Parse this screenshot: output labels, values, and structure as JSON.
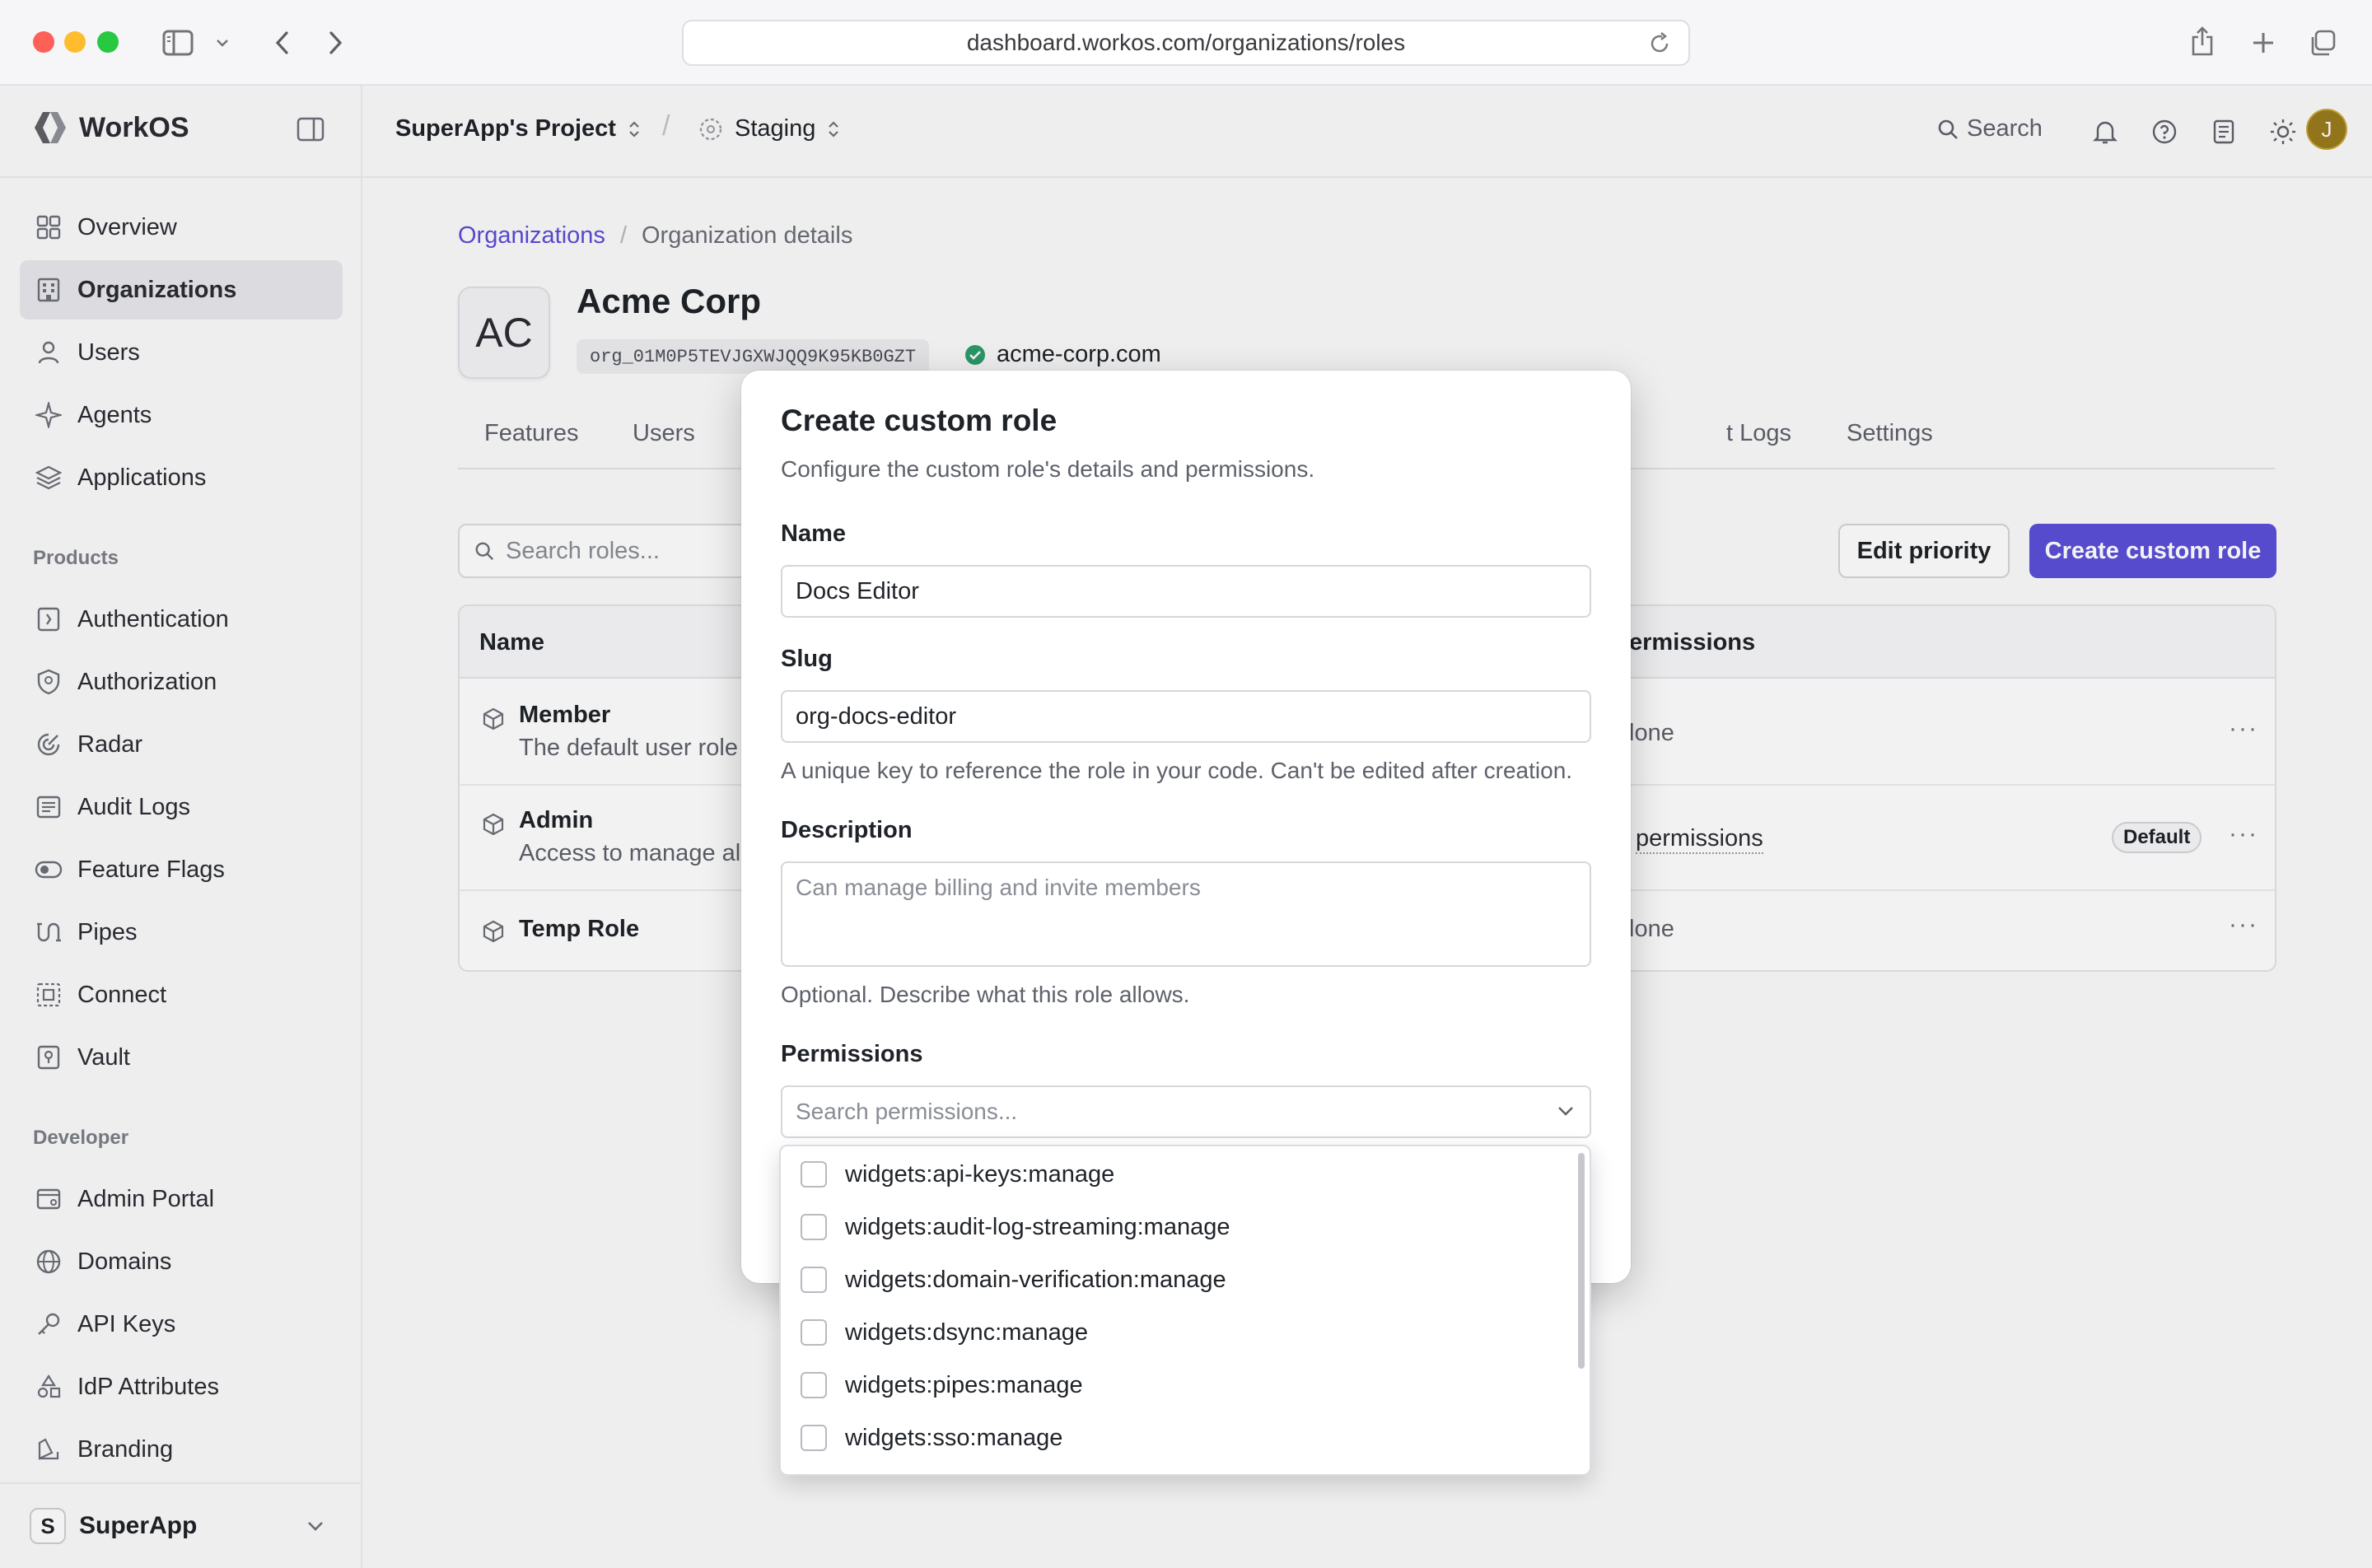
{
  "browser": {
    "url": "dashboard.workos.com/organizations/roles"
  },
  "sidebar": {
    "brand": "WorkOS",
    "items": [
      {
        "label": "Overview",
        "icon": "grid-icon"
      },
      {
        "label": "Organizations",
        "icon": "building-icon",
        "active": true
      },
      {
        "label": "Users",
        "icon": "user-icon"
      },
      {
        "label": "Agents",
        "icon": "sparkle-icon"
      },
      {
        "label": "Applications",
        "icon": "layers-icon"
      }
    ],
    "products_label": "Products",
    "products": [
      {
        "label": "Authentication",
        "icon": "key-card-icon"
      },
      {
        "label": "Authorization",
        "icon": "shield-icon"
      },
      {
        "label": "Radar",
        "icon": "radar-icon"
      },
      {
        "label": "Audit Logs",
        "icon": "list-icon"
      },
      {
        "label": "Feature Flags",
        "icon": "toggle-icon"
      },
      {
        "label": "Pipes",
        "icon": "pipes-icon"
      },
      {
        "label": "Connect",
        "icon": "connect-icon"
      },
      {
        "label": "Vault",
        "icon": "vault-icon"
      }
    ],
    "developer_label": "Developer",
    "developer": [
      {
        "label": "Admin Portal",
        "icon": "portal-icon"
      },
      {
        "label": "Domains",
        "icon": "globe-icon"
      },
      {
        "label": "API Keys",
        "icon": "key-icon"
      },
      {
        "label": "IdP Attributes",
        "icon": "shapes-icon"
      },
      {
        "label": "Branding",
        "icon": "brush-icon"
      }
    ],
    "workspace": {
      "initial": "S",
      "name": "SuperApp"
    }
  },
  "topbar": {
    "project": "SuperApp's Project",
    "environment": "Staging",
    "search_label": "Search",
    "user_initial": "J"
  },
  "page": {
    "breadcrumb_link": "Organizations",
    "breadcrumb_current": "Organization details",
    "org_initials": "AC",
    "org_name": "Acme Corp",
    "org_id": "org_01M0P5TEVJGXWJQQ9K95KB0GZT",
    "org_domain": "acme-corp.com",
    "tabs": [
      "Features",
      "Users",
      "t Logs",
      "Settings"
    ],
    "search_placeholder": "Search roles...",
    "edit_priority": "Edit priority",
    "create_role": "Create custom role",
    "table": {
      "col_name": "Name",
      "col_permissions": "ermissions",
      "rows": [
        {
          "name": "Member",
          "desc": "The default user role",
          "permissions": "lone",
          "default": ""
        },
        {
          "name": "Admin",
          "desc": "Access to manage all",
          "permissions": "permissions",
          "default": "Default"
        },
        {
          "name": "Temp Role",
          "desc": "",
          "permissions": "lone",
          "default": ""
        }
      ]
    }
  },
  "modal": {
    "title": "Create custom role",
    "subtitle": "Configure the custom role's details and permissions.",
    "name_label": "Name",
    "name_value": "Docs Editor",
    "slug_label": "Slug",
    "slug_value": "org-docs-editor",
    "slug_help": "A unique key to reference the role in your code. Can't be edited after creation.",
    "description_label": "Description",
    "description_placeholder": "Can manage billing and invite members",
    "description_help": "Optional. Describe what this role allows.",
    "permissions_label": "Permissions",
    "permissions_placeholder": "Search permissions...",
    "permission_options": [
      "widgets:api-keys:manage",
      "widgets:audit-log-streaming:manage",
      "widgets:domain-verification:manage",
      "widgets:dsync:manage",
      "widgets:pipes:manage",
      "widgets:sso:manage"
    ]
  },
  "colors": {
    "accent": "#5b4fd9",
    "link": "#5b4cd6",
    "verified": "#2e9e6b"
  }
}
